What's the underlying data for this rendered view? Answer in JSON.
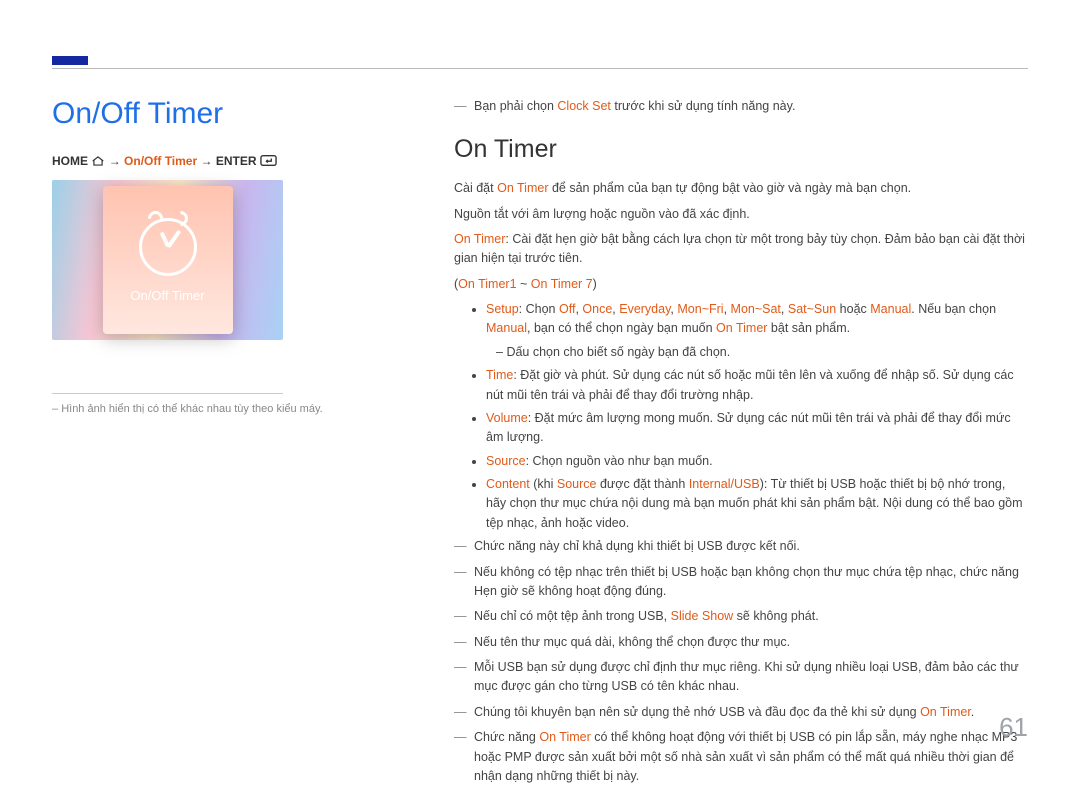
{
  "page_number": "61",
  "title": "On/Off Timer",
  "breadcrumb": {
    "home": "HOME",
    "mid": "On/Off Timer",
    "enter": "ENTER"
  },
  "thumb_label": "On/Off Timer",
  "caption_prefix": "–",
  "caption_text": "Hình ảnh hiển thị có thể khác nhau tùy theo kiểu máy.",
  "precond": {
    "dash": "―",
    "pre": "Bạn phải chọn ",
    "accent": "Clock Set",
    "post": " trước khi sử dụng tính năng này."
  },
  "h2": "On Timer",
  "p_set_pre": "Cài đặt ",
  "p_set_accent": "On Timer",
  "p_set_post": " để sản phẩm của bạn tự động bật vào giờ và ngày mà bạn chọn.",
  "p_source_off": "Nguồn tắt với âm lượng hoặc nguồn vào đã xác định.",
  "p_timer": {
    "accent": "On Timer",
    "text": ": Cài đặt hẹn giờ bật bằng cách lựa chọn từ một trong bảy tùy chọn. Đảm bảo bạn cài đặt thời gian hiện tại trước tiên."
  },
  "p_range": {
    "a": "On Timer1",
    "sep": " ~ ",
    "b": "On Timer 7"
  },
  "setup": {
    "label": "Setup",
    "pre": ": Chọn ",
    "opts": [
      "Off",
      "Once",
      "Everyday",
      "Mon~Fri",
      "Mon~Sat",
      "Sat~Sun"
    ],
    "or": " hoặc ",
    "manual": "Manual",
    "post_a": ". Nếu bạn chọn ",
    "post_b": ", bạn có thể chọn ngày bạn muốn ",
    "ontimer": "On Timer",
    "tail": " bật sản phẩm."
  },
  "setup_sub": "Dấu chọn cho biết số ngày bạn đã chọn.",
  "time": {
    "label": "Time",
    "text": ": Đặt giờ và phút. Sử dụng các nút số hoặc mũi tên lên và xuống để nhập số. Sử dụng các nút mũi tên trái và phải để thay đổi trường nhập."
  },
  "volume": {
    "label": "Volume",
    "text": ": Đặt mức âm lượng mong muốn. Sử dụng các nút mũi tên trái và phải để thay đổi mức âm lượng."
  },
  "source": {
    "label": "Source",
    "text": ": Chọn nguồn vào như bạn muốn."
  },
  "content": {
    "label": "Content",
    "pre": " (khi ",
    "srclabel": "Source",
    "mid": " được đặt thành ",
    "iusb": "Internal/USB",
    "post": "): Từ thiết bị USB hoặc thiết bị bộ nhớ trong, hãy chọn thư mục chứa nội dung mà bạn muốn phát khi sản phẩm bật. Nội dung có thể bao gồm tệp nhạc, ảnh hoặc video."
  },
  "notes": [
    {
      "text": "Chức năng này chỉ khả dụng khi thiết bị USB được kết nối."
    },
    {
      "text": "Nếu không có tệp nhạc trên thiết bị USB hoặc bạn không chọn thư mục chứa tệp nhạc, chức năng Hẹn giờ sẽ không hoạt động đúng."
    },
    {
      "pre": "Nếu chỉ có một tệp ảnh trong USB, ",
      "accent": "Slide Show",
      "post": " sẽ không phát."
    },
    {
      "text": "Nếu tên thư mục quá dài, không thể chọn được thư mục."
    },
    {
      "text": "Mỗi USB bạn sử dụng được chỉ định thư mục riêng. Khi sử dụng nhiều loại USB, đảm bảo các thư mục được gán cho từng USB có tên khác nhau."
    },
    {
      "pre": "Chúng tôi khuyên bạn nên sử dụng thẻ nhớ USB và đầu đọc đa thẻ khi sử dụng ",
      "accent": "On Timer",
      "post": "."
    },
    {
      "pre": "Chức năng ",
      "accent": "On Timer",
      "post": " có thể không hoạt động với thiết bị USB có pin lắp sẵn, máy nghe nhạc MP3 hoặc PMP được sản xuất bởi một số nhà sản xuất vì sản phẩm có thể mất quá nhiều thời gian để nhận dạng những thiết bị này."
    }
  ],
  "dash_char": "―"
}
